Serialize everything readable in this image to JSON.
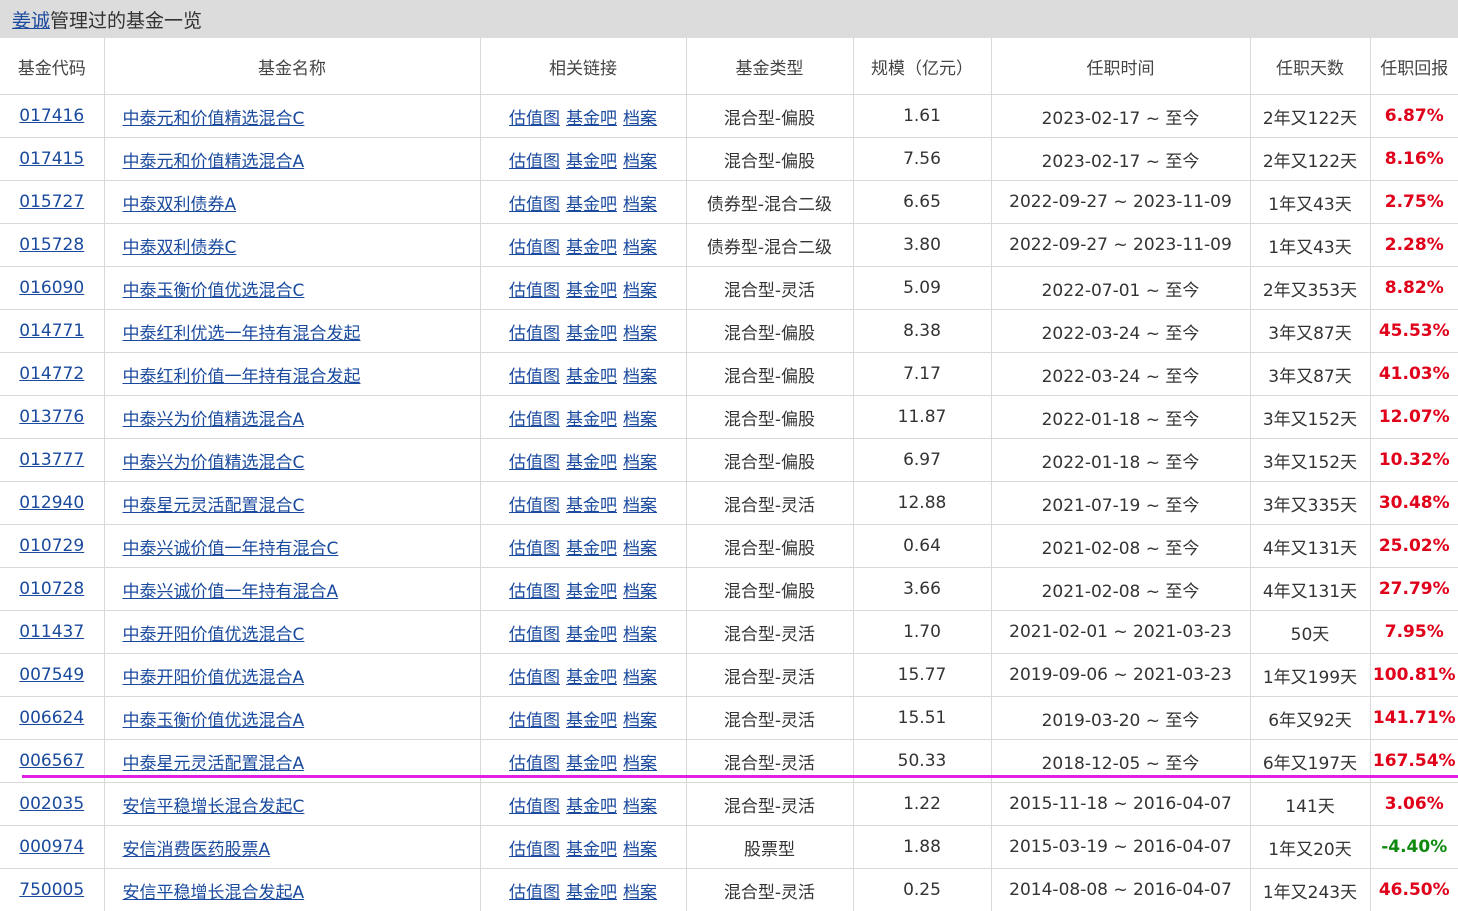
{
  "header": {
    "manager_name": "姜诚",
    "title_suffix": "管理过的基金一览"
  },
  "columns": [
    "基金代码",
    "基金名称",
    "相关链接",
    "基金类型",
    "规模（亿元）",
    "任职时间",
    "任职天数",
    "任职回报"
  ],
  "link_labels": [
    "估值图",
    "基金吧",
    "档案"
  ],
  "highlight_color": "#e41fe4",
  "rows": [
    {
      "code": "017416",
      "name": "中泰元和价值精选混合C",
      "type": "混合型-偏股",
      "size": "1.61",
      "period": "2023-02-17 ~ 至今",
      "days": "2年又122天",
      "return": "6.87%"
    },
    {
      "code": "017415",
      "name": "中泰元和价值精选混合A",
      "type": "混合型-偏股",
      "size": "7.56",
      "period": "2023-02-17 ~ 至今",
      "days": "2年又122天",
      "return": "8.16%"
    },
    {
      "code": "015727",
      "name": "中泰双利债券A",
      "type": "债券型-混合二级",
      "size": "6.65",
      "period": "2022-09-27 ~ 2023-11-09",
      "days": "1年又43天",
      "return": "2.75%"
    },
    {
      "code": "015728",
      "name": "中泰双利债券C",
      "type": "债券型-混合二级",
      "size": "3.80",
      "period": "2022-09-27 ~ 2023-11-09",
      "days": "1年又43天",
      "return": "2.28%"
    },
    {
      "code": "016090",
      "name": "中泰玉衡价值优选混合C",
      "type": "混合型-灵活",
      "size": "5.09",
      "period": "2022-07-01 ~ 至今",
      "days": "2年又353天",
      "return": "8.82%"
    },
    {
      "code": "014771",
      "name": "中泰红利优选一年持有混合发起",
      "type": "混合型-偏股",
      "size": "8.38",
      "period": "2022-03-24 ~ 至今",
      "days": "3年又87天",
      "return": "45.53%"
    },
    {
      "code": "014772",
      "name": "中泰红利价值一年持有混合发起",
      "type": "混合型-偏股",
      "size": "7.17",
      "period": "2022-03-24 ~ 至今",
      "days": "3年又87天",
      "return": "41.03%"
    },
    {
      "code": "013776",
      "name": "中泰兴为价值精选混合A",
      "type": "混合型-偏股",
      "size": "11.87",
      "period": "2022-01-18 ~ 至今",
      "days": "3年又152天",
      "return": "12.07%"
    },
    {
      "code": "013777",
      "name": "中泰兴为价值精选混合C",
      "type": "混合型-偏股",
      "size": "6.97",
      "period": "2022-01-18 ~ 至今",
      "days": "3年又152天",
      "return": "10.32%"
    },
    {
      "code": "012940",
      "name": "中泰星元灵活配置混合C",
      "type": "混合型-灵活",
      "size": "12.88",
      "period": "2021-07-19 ~ 至今",
      "days": "3年又335天",
      "return": "30.48%"
    },
    {
      "code": "010729",
      "name": "中泰兴诚价值一年持有混合C",
      "type": "混合型-偏股",
      "size": "0.64",
      "period": "2021-02-08 ~ 至今",
      "days": "4年又131天",
      "return": "25.02%"
    },
    {
      "code": "010728",
      "name": "中泰兴诚价值一年持有混合A",
      "type": "混合型-偏股",
      "size": "3.66",
      "period": "2021-02-08 ~ 至今",
      "days": "4年又131天",
      "return": "27.79%"
    },
    {
      "code": "011437",
      "name": "中泰开阳价值优选混合C",
      "type": "混合型-灵活",
      "size": "1.70",
      "period": "2021-02-01 ~ 2021-03-23",
      "days": "50天",
      "return": "7.95%"
    },
    {
      "code": "007549",
      "name": "中泰开阳价值优选混合A",
      "type": "混合型-灵活",
      "size": "15.77",
      "period": "2019-09-06 ~ 2021-03-23",
      "days": "1年又199天",
      "return": "100.81%"
    },
    {
      "code": "006624",
      "name": "中泰玉衡价值优选混合A",
      "type": "混合型-灵活",
      "size": "15.51",
      "period": "2019-03-20 ~ 至今",
      "days": "6年又92天",
      "return": "141.71%"
    },
    {
      "code": "006567",
      "name": "中泰星元灵活配置混合A",
      "type": "混合型-灵活",
      "size": "50.33",
      "period": "2018-12-05 ~ 至今",
      "days": "6年又197天",
      "return": "167.54%"
    },
    {
      "code": "002035",
      "name": "安信平稳增长混合发起C",
      "type": "混合型-灵活",
      "size": "1.22",
      "period": "2015-11-18 ~ 2016-04-07",
      "days": "141天",
      "return": "3.06%"
    },
    {
      "code": "000974",
      "name": "安信消费医药股票A",
      "type": "股票型",
      "size": "1.88",
      "period": "2015-03-19 ~ 2016-04-07",
      "days": "1年又20天",
      "return": "-4.40%"
    },
    {
      "code": "750005",
      "name": "安信平稳增长混合发起A",
      "type": "混合型-灵活",
      "size": "0.25",
      "period": "2014-08-08 ~ 2016-04-07",
      "days": "1年又243天",
      "return": "46.50%"
    }
  ]
}
